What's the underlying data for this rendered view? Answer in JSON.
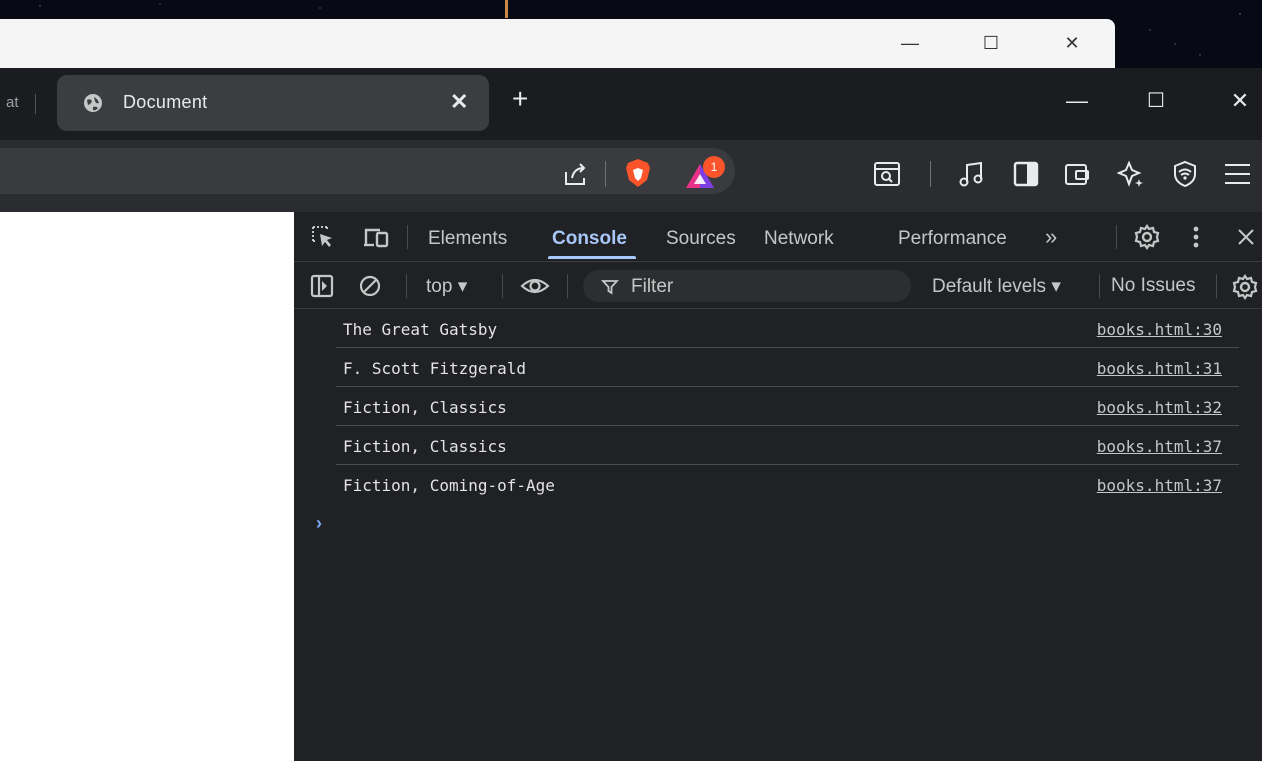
{
  "background_window": {
    "controls": {
      "minimize": "—",
      "maximize": "☐",
      "close": "✕"
    }
  },
  "tabs": {
    "previous_tab_fragment": "at",
    "active_tab": {
      "title": "Document",
      "close": "✕"
    },
    "new_tab": "+"
  },
  "window_controls": {
    "minimize": "—",
    "maximize": "☐",
    "close": "✕"
  },
  "toolbar": {
    "rewards_badge_count": "1"
  },
  "devtools": {
    "tabs": [
      {
        "label": "Elements",
        "active": false
      },
      {
        "label": "Console",
        "active": true
      },
      {
        "label": "Sources",
        "active": false
      },
      {
        "label": "Network",
        "active": false
      },
      {
        "label": "Performance",
        "active": false
      }
    ],
    "more_tabs": "»",
    "console_bar": {
      "context": "top ▾",
      "filter_placeholder": "Filter",
      "levels": "Default levels ▾",
      "issues": "No Issues"
    },
    "log": [
      {
        "message": "The Great Gatsby",
        "source": "books.html:30"
      },
      {
        "message": "F. Scott Fitzgerald",
        "source": "books.html:31"
      },
      {
        "message": "Fiction, Classics",
        "source": "books.html:32"
      },
      {
        "message": "Fiction, Classics",
        "source": "books.html:37"
      },
      {
        "message": "Fiction, Coming-of-Age",
        "source": "books.html:37"
      }
    ],
    "prompt": "›"
  },
  "colors": {
    "accent": "#a8c7fa",
    "brave_orange": "#fb542b",
    "devtools_bg": "#202124"
  }
}
